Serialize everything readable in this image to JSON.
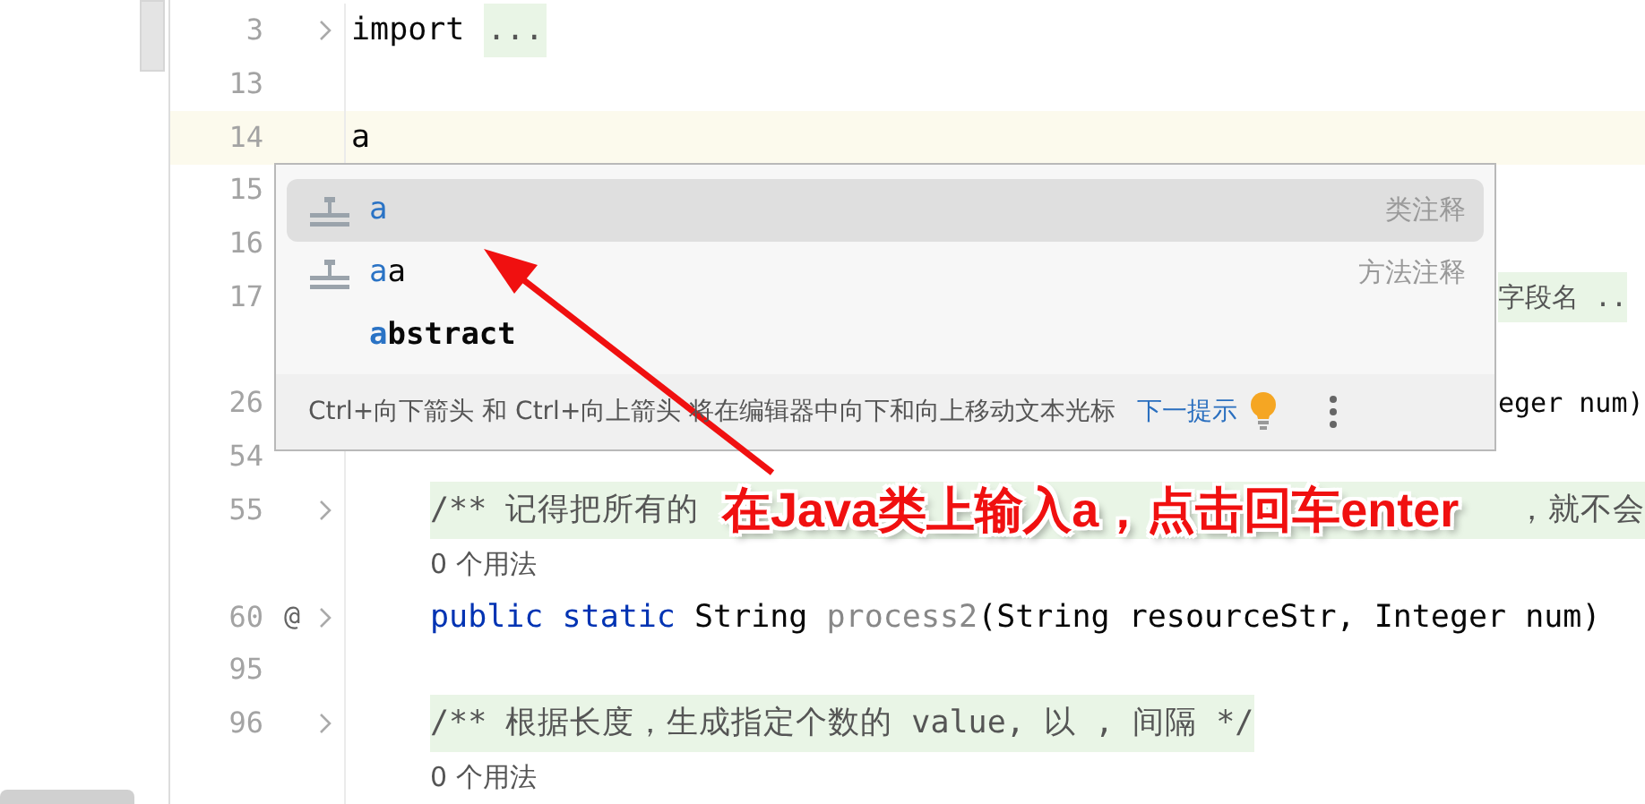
{
  "editor": {
    "lines": [
      {
        "number": "3",
        "fold": true,
        "kind": "top",
        "segments": [
          {
            "text": "import ",
            "kind": "plain"
          },
          {
            "text": "...",
            "kind": "folded"
          }
        ]
      },
      {
        "number": "13",
        "kind": "top"
      },
      {
        "number": "14",
        "kind": "top",
        "current": true,
        "segments": [
          {
            "text": "a",
            "kind": "plain"
          }
        ]
      },
      {
        "number": "15",
        "kind": "top"
      },
      {
        "number": "16",
        "kind": "top"
      },
      {
        "number": "17",
        "kind": "covered",
        "segments": [
          {
            "text": "字段名 ..",
            "kind": "comment"
          }
        ]
      },
      {
        "kind": "top"
      },
      {
        "number": "26",
        "kind": "covered",
        "segments": [
          {
            "text": "eger num)",
            "kind": "plain"
          }
        ]
      },
      {
        "number": "54",
        "kind": "top"
      },
      {
        "number": "55",
        "fold": true,
        "kind": "member",
        "segments": [
          {
            "text": "/** 记得把所有的",
            "kind": "comment"
          },
          {
            "text": "，就不会",
            "kind": "comment_tail"
          }
        ]
      },
      {
        "kind": "member",
        "segments": [
          {
            "text": "0 个用法",
            "kind": "hint"
          }
        ]
      },
      {
        "number": "60",
        "marker": "@",
        "fold": true,
        "kind": "member",
        "segments": [
          {
            "text": "public static",
            "kind": "keyword"
          },
          {
            "text": " String ",
            "kind": "plain"
          },
          {
            "text": "process2",
            "kind": "method"
          },
          {
            "text": "(String resourceStr, Integer num)",
            "kind": "plain"
          }
        ]
      },
      {
        "number": "95",
        "kind": "top"
      },
      {
        "number": "96",
        "fold": true,
        "kind": "member",
        "segments": [
          {
            "text": "/** 根据长度，生成指定个数的 value, 以 , 间隔 */",
            "kind": "comment"
          }
        ]
      },
      {
        "kind": "member",
        "segments": [
          {
            "text": "0 个用法",
            "kind": "hint"
          }
        ]
      }
    ]
  },
  "completion": {
    "items": [
      {
        "kind": "template",
        "match": "a",
        "hint": "类注释",
        "selected": true
      },
      {
        "kind": "template",
        "match": "a",
        "rest": "a",
        "hint": "方法注释",
        "selected": false
      },
      {
        "kind": "keyword",
        "match": "a",
        "rest": "bstract",
        "selected": false
      }
    ],
    "tip": "Ctrl+向下箭头 和 Ctrl+向上箭头 将在编辑器中向下和向上移动文本光标",
    "next_tip": "下一提示"
  },
  "annotation": {
    "text": "在Java类上输入a，点击回车enter"
  }
}
